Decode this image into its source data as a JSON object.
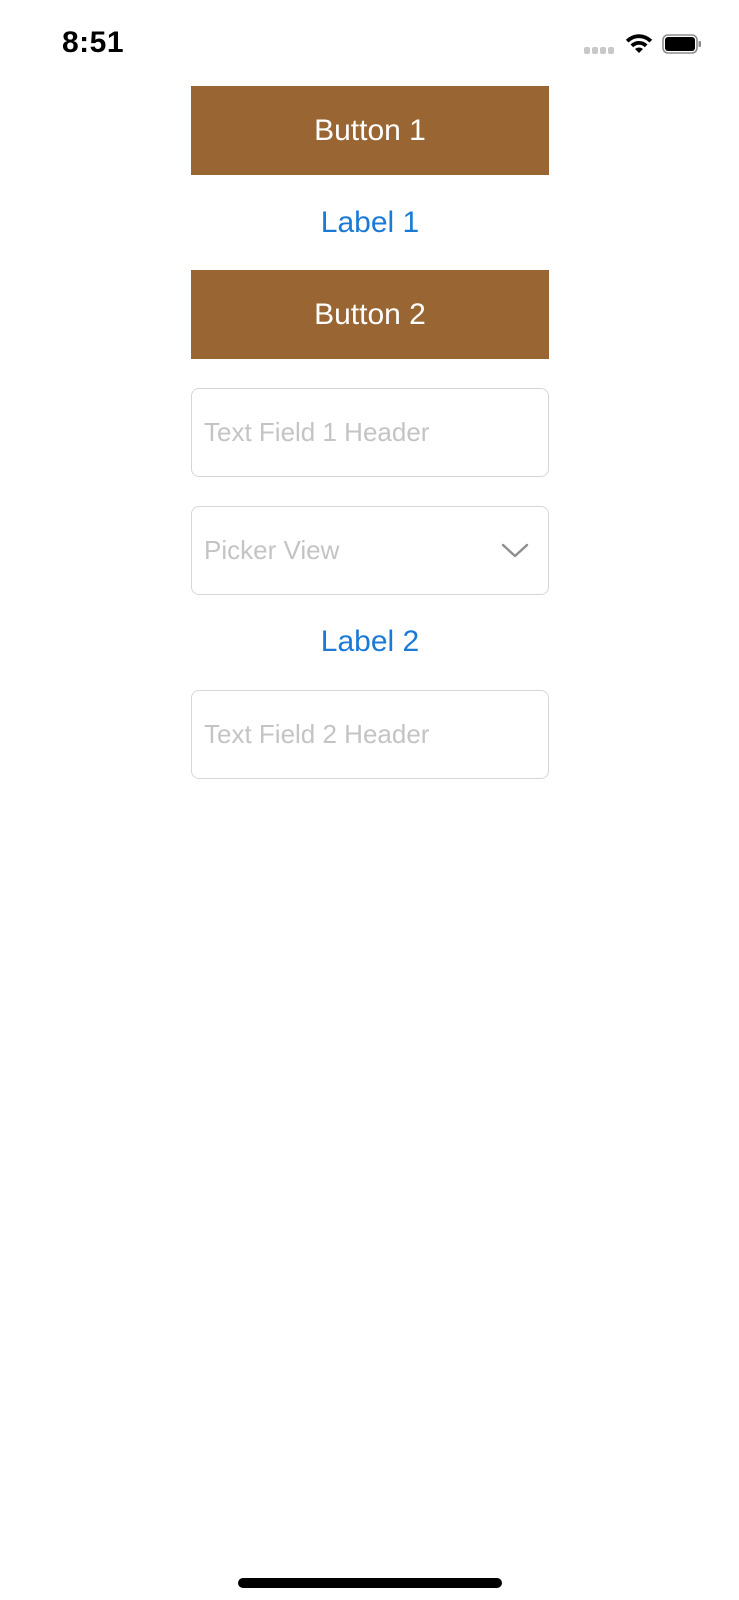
{
  "status_bar": {
    "time": "8:51",
    "icons": [
      "signal-icon",
      "wifi-icon",
      "battery-icon"
    ]
  },
  "main": {
    "button_1": {
      "label": "Button 1"
    },
    "label_1": {
      "text": "Label 1"
    },
    "button_2": {
      "label": "Button 2"
    },
    "text_field_1": {
      "placeholder": "Text Field 1 Header",
      "value": ""
    },
    "picker": {
      "placeholder": "Picker View",
      "icon": "chevron-down-icon"
    },
    "label_2": {
      "text": "Label 2"
    },
    "text_field_2": {
      "placeholder": "Text Field 2 Header",
      "value": ""
    }
  },
  "colors": {
    "button_background": "#996633",
    "button_text": "#ffffff",
    "label_text": "#1a7ad6",
    "placeholder_text": "#c4c4c7",
    "field_border": "#d6d6d6"
  }
}
